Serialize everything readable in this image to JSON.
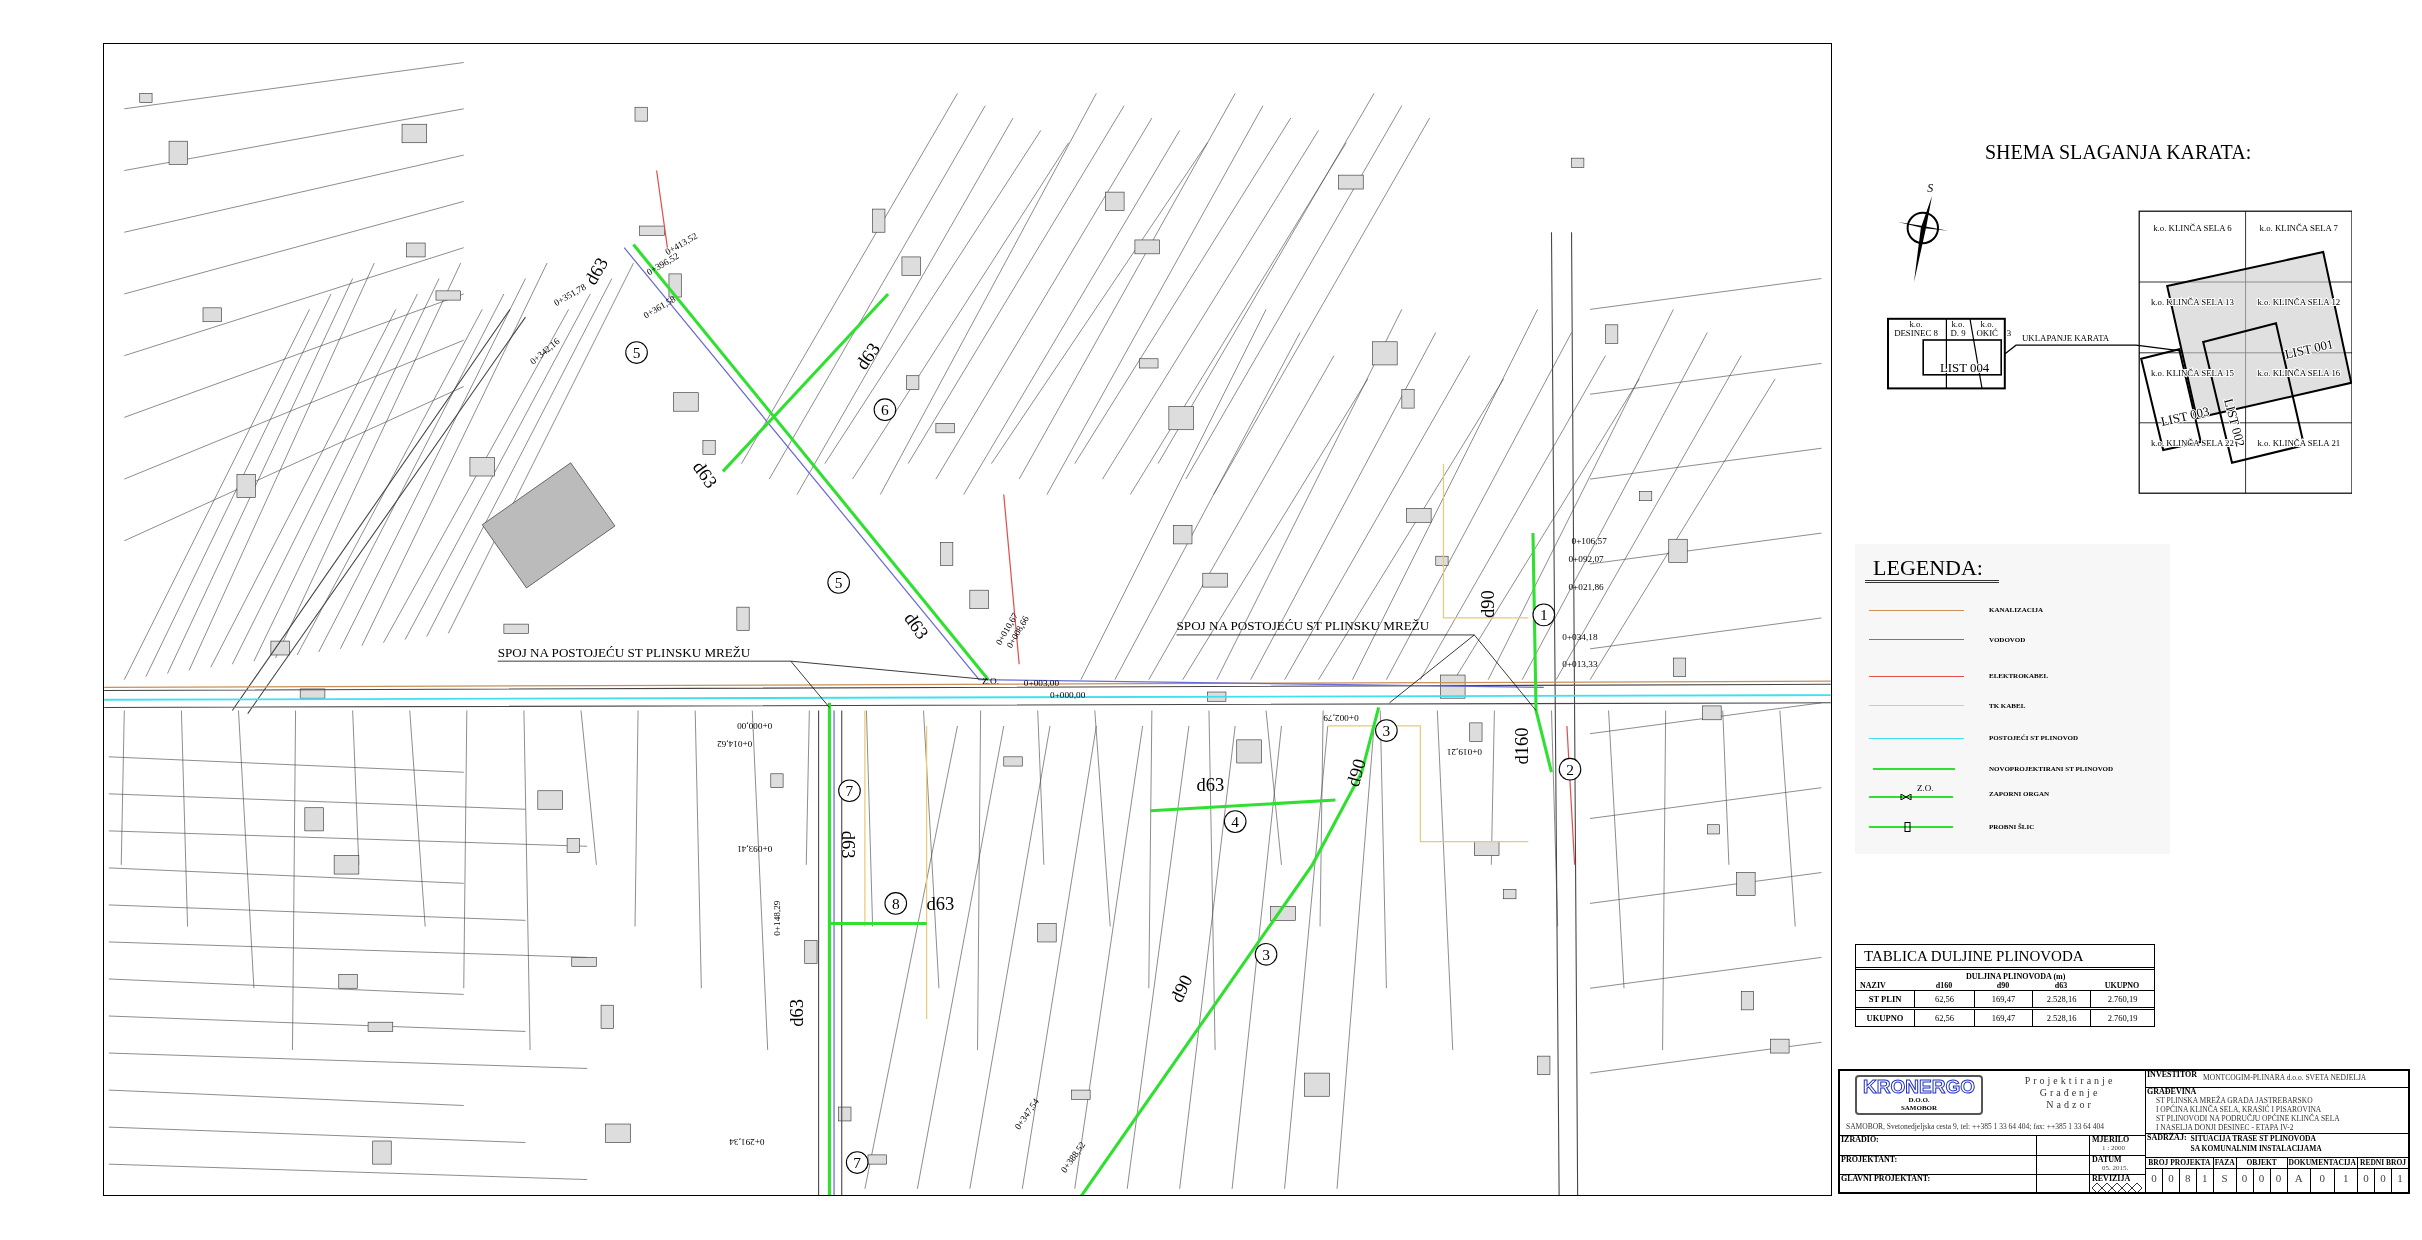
{
  "map": {
    "callouts": [
      "SPOJ NA POSTOJEĆU ST PLINSKU MREŽU",
      "SPOJ NA POSTOJEĆU ST PLINSKU MREŽU"
    ],
    "pipe_labels": [
      "d63",
      "d63",
      "d63",
      "d63",
      "d63",
      "d63",
      "d63",
      "d63",
      "d90",
      "d90",
      "d160",
      "d90"
    ],
    "section_numbers": [
      "5",
      "6",
      "5",
      "1",
      "3",
      "2",
      "4",
      "7",
      "8",
      "3",
      "7"
    ],
    "chainages": [
      "0+413,52",
      "0+396,52",
      "0+361,58",
      "0+351,78",
      "0+342,16",
      "0+106,57",
      "0+092,07",
      "0+021,86",
      "0+034,18",
      "0+013,33",
      "0+003,00",
      "0+000,00",
      "0+010,67",
      "0+008,66",
      "Z.O.",
      "0+000,00",
      "0+014,62",
      "0+002,79",
      "0+019,21",
      "0+093,41",
      "0+148,29",
      "0+291,34",
      "0+347,54",
      "0+388,52"
    ]
  },
  "key_plan": {
    "title": "SHEMA SLAGANJA KARATA:",
    "compass_label": "S",
    "overview": {
      "cells": [
        {
          "line_1": "k.o.",
          "line_2": "DESINEC 8"
        },
        {
          "line_1": "k.o.",
          "line_2": "D. 9"
        },
        {
          "line_1": "k.o.",
          "line_2": "OKIĆ"
        }
      ],
      "extra": "3",
      "sheet": "LIST 004",
      "link_label": "UKLAPANJE KARATA"
    },
    "grid_cells": [
      "k.o. KLINČA SELA 6",
      "k.o. KLINČA SELA 7",
      "k.o. KLINČA SELA 13",
      "k.o. KLINČA SELA 12",
      "k.o. KLINČA SELA 15",
      "k.o. KLINČA SELA 16",
      "k.o. KLINČA SELA 22",
      "k.o. KLINČA SELA 21"
    ],
    "sheets": [
      "LIST 001",
      "LIST 002",
      "LIST 003"
    ]
  },
  "legend": {
    "title": "LEGENDA:",
    "items": [
      {
        "kind": "line",
        "label": "KANALIZACIJA",
        "color": "#c8905a"
      },
      {
        "kind": "line",
        "label": "VODOVOD",
        "color": "#6a6ad8"
      },
      {
        "kind": "line",
        "label": "ELEKTROKABEL",
        "color": "#e05050"
      },
      {
        "kind": "line",
        "label": "TK KABEL",
        "color": "#ecc878"
      },
      {
        "kind": "line",
        "label": "POSTOJEĆI ST PLINOVOD",
        "color": "#40e0f0"
      },
      {
        "kind": "thick",
        "label": "NOVOPROJEKTIRANI ST PLINOVOD",
        "color": "#30e030"
      },
      {
        "kind": "valve",
        "label": "ZAPORNI ORGAN",
        "color": "#30e030",
        "symbol_label": "Z.O."
      },
      {
        "kind": "test_point",
        "label": "PROBNI ŠLIC",
        "color": "#30e030"
      }
    ]
  },
  "length_table": {
    "title": "TABLICA DULJINE PLINOVODA",
    "group_header": "DULJINA PLINOVODA (m)",
    "columns": [
      "NAZIV",
      "d160",
      "d90",
      "d63",
      "UKUPNO"
    ],
    "rows": [
      [
        "ST PLIN",
        "62,56",
        "169,47",
        "2.528,16",
        "2.760,19"
      ],
      [
        "UKUPNO",
        "62,56",
        "169,47",
        "2.528,16",
        "2.760,19"
      ]
    ]
  },
  "title_block": {
    "logo": {
      "name": "KRONERGO",
      "line_1": "D.O.O.",
      "line_2": "SAMOBOR"
    },
    "services": [
      "Projektiranje",
      "Građenje",
      "Nadzor"
    ],
    "address": "SAMOBOR,  Svetonedjeljska  cesta 9,   tel: ++385 1 33 64 404;   fax: ++385 1 33 64 404",
    "people_labels": [
      "IZRADIO:",
      "PROJEKTANT:",
      "GLAVNI PROJEKTANT:"
    ],
    "scale_label": "MJERILO",
    "scale": "1 : 2000",
    "date_label": "DATUM",
    "date": "05. 2015.",
    "revision_label": "REVIZIJA",
    "investor_label": "INVESTITOR",
    "investor": "MONTCOGIM-PLINARA d.o.o. SVETA NEDJELJA",
    "building_label": "GRAĐEVINA",
    "building_lines": [
      "ST PLINSKA MREŽA  GRADA JASTREBARSKO",
      "I OPĆINA KLINČA SELA, KRAŠIĆ I PISAROVINA",
      "ST PLINOVODI NA PODRUČJU OPĆINE KLINČA SELA",
      "I NASELJA DONJI DESINEC - ETAPA IV-2"
    ],
    "content_label": "SADRŽAJ:",
    "content_lines": [
      "SITUACIJA TRASE ST PLINOVODA",
      "SA KOMUNALNIM INSTALACIJAMA"
    ],
    "code_groups": [
      {
        "label": "BROJ PROJEKTA",
        "digits": [
          "0",
          "0",
          "8",
          "1"
        ]
      },
      {
        "label": "FAZA",
        "digits": [
          "S"
        ]
      },
      {
        "label": "OBJEKT",
        "digits": [
          "0",
          "0",
          "0"
        ]
      },
      {
        "label": "DOKUMENTACIJA",
        "digits": [
          "A",
          "0",
          "1"
        ]
      },
      {
        "label": "REDNI BROJ",
        "digits": [
          "0",
          "0",
          "1"
        ]
      }
    ]
  }
}
